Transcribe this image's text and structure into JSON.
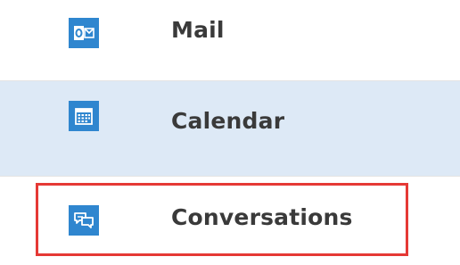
{
  "nav": {
    "items": [
      {
        "label": "Mail",
        "icon": "outlook-mail-icon"
      },
      {
        "label": "Calendar",
        "icon": "calendar-icon"
      },
      {
        "label": "Conversations",
        "icon": "chat-bubbles-icon"
      }
    ]
  },
  "colors": {
    "icon_bg": "#2f86cf",
    "selected_bg": "#dde9f6",
    "highlight_border": "#e53935",
    "label_text": "#3a3a3a"
  }
}
